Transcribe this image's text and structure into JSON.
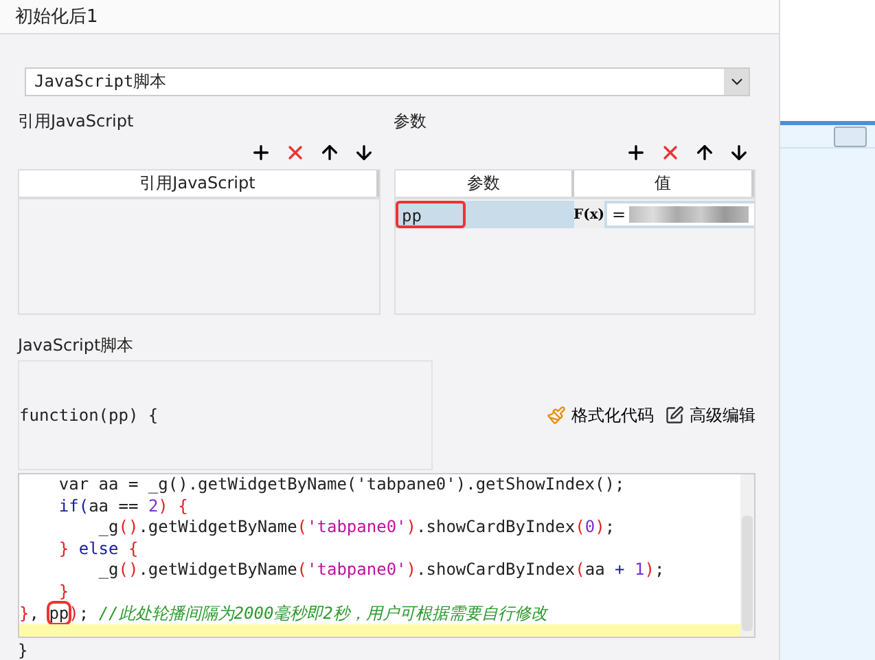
{
  "window": {
    "title": "初始化后1"
  },
  "script_type": {
    "value": "JavaScript脚本"
  },
  "references": {
    "title": "引用JavaScript",
    "columns": [
      "引用JavaScript"
    ]
  },
  "parameters": {
    "title": "参数",
    "columns": [
      "参数",
      "值"
    ],
    "rows": [
      {
        "name": "pp",
        "selected": true,
        "highlighted": true,
        "formula_label": "F(x)",
        "value": "="
      }
    ]
  },
  "script": {
    "title": "JavaScript脚本",
    "signature": "function(pp) {",
    "buttons": [
      "格式化代码",
      "高级编辑"
    ],
    "lines": [
      {
        "current": false,
        "tokens": [
          {
            "kind": "plain",
            "text": "    var aa = _g().getWidgetByName('tabpane0').getShowIndex();"
          }
        ]
      },
      {
        "current": false,
        "tokens": [
          {
            "kind": "kw",
            "text": "    if("
          },
          {
            "kind": "plain",
            "text": "aa == "
          },
          {
            "kind": "num",
            "text": "2"
          },
          {
            "kind": "punct",
            "text": ") {"
          }
        ]
      },
      {
        "current": false,
        "tokens": [
          {
            "kind": "plain",
            "text": "        _g"
          },
          {
            "kind": "punct",
            "text": "()"
          },
          {
            "kind": "plain",
            "text": ".getWidgetByName"
          },
          {
            "kind": "punct",
            "text": "("
          },
          {
            "kind": "str",
            "text": "'tabpane0'"
          },
          {
            "kind": "punct",
            "text": ")"
          },
          {
            "kind": "plain",
            "text": ".showCardByIndex"
          },
          {
            "kind": "punct",
            "text": "("
          },
          {
            "kind": "num",
            "text": "0"
          },
          {
            "kind": "punct",
            "text": ")"
          },
          {
            "kind": "plain",
            "text": ";"
          }
        ]
      },
      {
        "current": false,
        "tokens": [
          {
            "kind": "punct",
            "text": "    }"
          },
          {
            "kind": "kw",
            "text": " else "
          },
          {
            "kind": "punct",
            "text": "{"
          }
        ]
      },
      {
        "current": false,
        "tokens": [
          {
            "kind": "plain",
            "text": "        _g"
          },
          {
            "kind": "punct",
            "text": "()"
          },
          {
            "kind": "plain",
            "text": ".getWidgetByName"
          },
          {
            "kind": "punct",
            "text": "("
          },
          {
            "kind": "str",
            "text": "'tabpane0'"
          },
          {
            "kind": "punct",
            "text": ")"
          },
          {
            "kind": "plain",
            "text": ".showCardByIndex"
          },
          {
            "kind": "punct",
            "text": "("
          },
          {
            "kind": "plain",
            "text": "aa "
          },
          {
            "kind": "kw",
            "text": "+ "
          },
          {
            "kind": "num",
            "text": "1"
          },
          {
            "kind": "punct",
            "text": ")"
          },
          {
            "kind": "plain",
            "text": ";"
          }
        ]
      },
      {
        "current": false,
        "tokens": [
          {
            "kind": "punct",
            "text": "    }"
          }
        ]
      },
      {
        "current": false,
        "tokens": [
          {
            "kind": "punct",
            "text": "}"
          },
          {
            "kind": "plain",
            "text": ", "
          },
          {
            "kind": "mark",
            "text": "pp"
          },
          {
            "kind": "punct",
            "text": ")"
          },
          {
            "kind": "plain",
            "text": "; "
          },
          {
            "kind": "comment",
            "text": "//此处轮播间隔为2000毫秒即2秒，用户可根据需要自行修改"
          }
        ]
      },
      {
        "current": true
      }
    ],
    "closing": "}"
  }
}
